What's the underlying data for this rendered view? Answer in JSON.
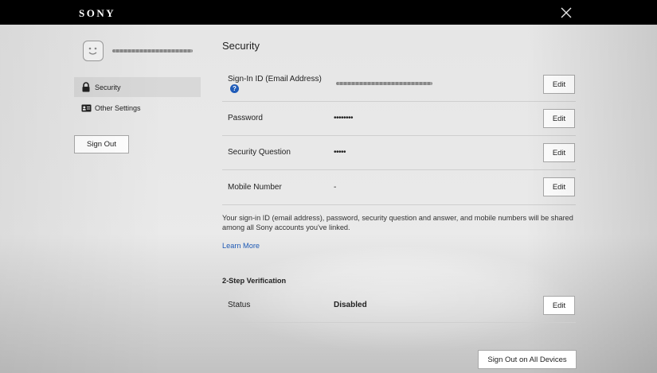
{
  "header": {
    "brand": "SONY"
  },
  "sidebar": {
    "items": [
      {
        "label": "Security",
        "icon": "lock-icon",
        "active": true
      },
      {
        "label": "Other Settings",
        "icon": "id-card-icon",
        "active": false
      }
    ],
    "sign_out_label": "Sign Out"
  },
  "main": {
    "title": "Security",
    "rows": [
      {
        "label": "Sign-In ID (Email Address)",
        "value": "",
        "edit_label": "Edit"
      },
      {
        "label": "Password",
        "value": "••••••••",
        "edit_label": "Edit"
      },
      {
        "label": "Security Question",
        "value": "•••••",
        "edit_label": "Edit"
      },
      {
        "label": "Mobile Number",
        "value": "-",
        "edit_label": "Edit"
      }
    ],
    "note": "Your sign-in ID (email address), password, security question and answer, and mobile numbers will be shared among all Sony accounts you've linked.",
    "learn_more": "Learn More",
    "two_step": {
      "title": "2-Step Verification",
      "status_label": "Status",
      "status_value": "Disabled",
      "edit_label": "Edit"
    },
    "sign_out_all_label": "Sign Out on All Devices"
  },
  "colors": {
    "header_bg": "#000000",
    "link": "#1f5bb8",
    "active_item_bg": "#d8d8d8"
  }
}
